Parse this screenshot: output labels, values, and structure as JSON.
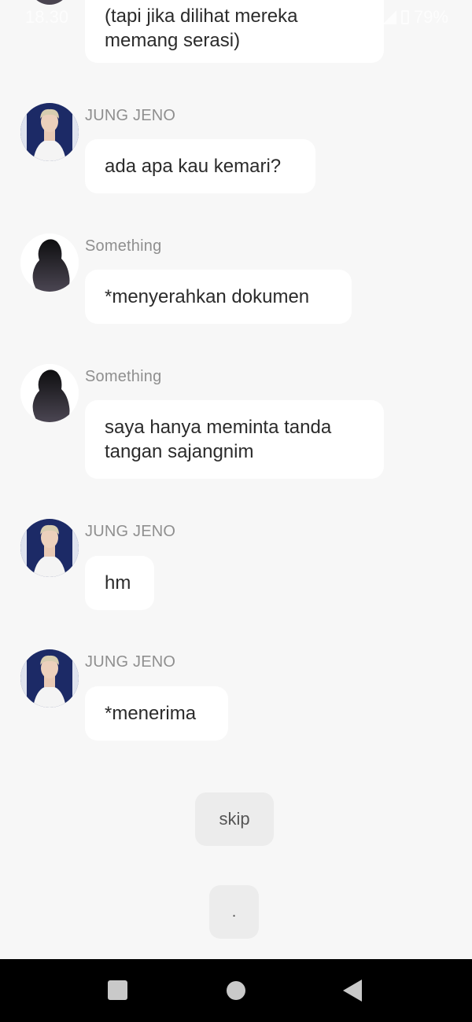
{
  "status_bar": {
    "time": "18.30",
    "battery": "79%"
  },
  "messages": [
    {
      "sender": "",
      "text_lines": [
        "(tapi jika dilihat mereka",
        "memang serasi)"
      ],
      "avatar": "silhouette-avatar"
    },
    {
      "sender": "JUNG JENO",
      "text_lines": [
        "ada apa kau kemari?"
      ],
      "avatar": "jeno-avatar"
    },
    {
      "sender": "Something",
      "text_lines": [
        "*menyerahkan dokumen"
      ],
      "avatar": "silhouette-avatar"
    },
    {
      "sender": "Something",
      "text_lines": [
        "saya hanya meminta tanda",
        "tangan sajangnim"
      ],
      "avatar": "silhouette-avatar"
    },
    {
      "sender": "JUNG JENO",
      "text_lines": [
        "hm"
      ],
      "avatar": "jeno-avatar"
    },
    {
      "sender": "JUNG JENO",
      "text_lines": [
        "*menerima"
      ],
      "avatar": "jeno-avatar"
    }
  ],
  "buttons": {
    "skip_label": "skip",
    "dot_label": "."
  },
  "nav": {
    "recents": "square-icon",
    "home": "circle-icon",
    "back": "back-triangle-icon"
  },
  "colors": {
    "background": "#f7f7f7",
    "bubble": "#ffffff",
    "sender_text": "#8f8f8f",
    "message_text": "#2b2b2b",
    "button_bg": "#ececec",
    "nav_bar": "#000000"
  }
}
